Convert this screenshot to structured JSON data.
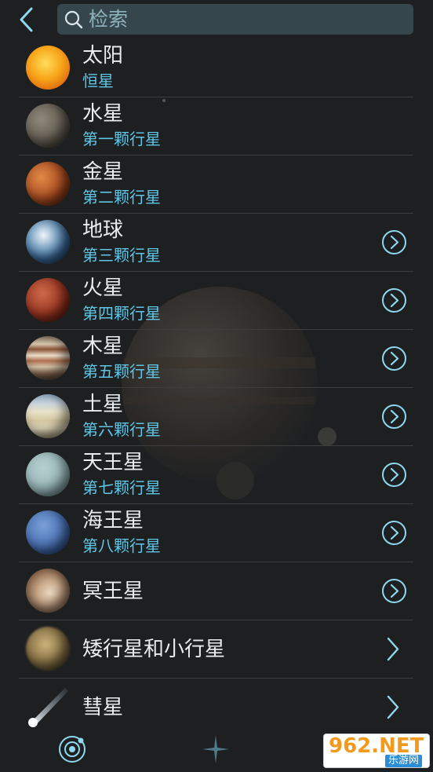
{
  "search": {
    "placeholder": "检索"
  },
  "items": [
    {
      "name": "太阳",
      "subtitle": "恒星",
      "icon": "sun-icon",
      "has_detail": false
    },
    {
      "name": "水星",
      "subtitle": "第一颗行星",
      "icon": "mercury-icon",
      "has_detail": false
    },
    {
      "name": "金星",
      "subtitle": "第二颗行星",
      "icon": "venus-icon",
      "has_detail": false
    },
    {
      "name": "地球",
      "subtitle": "第三颗行星",
      "icon": "earth-icon",
      "has_detail": true
    },
    {
      "name": "火星",
      "subtitle": "第四颗行星",
      "icon": "mars-icon",
      "has_detail": true
    },
    {
      "name": "木星",
      "subtitle": "第五颗行星",
      "icon": "jupiter-icon",
      "has_detail": true
    },
    {
      "name": "土星",
      "subtitle": "第六颗行星",
      "icon": "saturn-icon",
      "has_detail": true
    },
    {
      "name": "天王星",
      "subtitle": "第七颗行星",
      "icon": "uranus-icon",
      "has_detail": true
    },
    {
      "name": "海王星",
      "subtitle": "第八颗行星",
      "icon": "neptune-icon",
      "has_detail": true
    },
    {
      "name": "冥王星",
      "subtitle": "",
      "icon": "pluto-icon",
      "has_detail": true
    },
    {
      "name": "矮行星和小行星",
      "subtitle": "",
      "icon": "dwarf-planet-icon",
      "has_detail": false
    },
    {
      "name": "彗星",
      "subtitle": "",
      "icon": "comet-icon",
      "has_detail": false
    }
  ],
  "watermark": {
    "main": "962.NET",
    "sub": "乐游网"
  },
  "colors": {
    "background": "#1d1f21",
    "search_bg": "#35474d",
    "accent": "#5fc6e6",
    "text": "#e9edee"
  }
}
